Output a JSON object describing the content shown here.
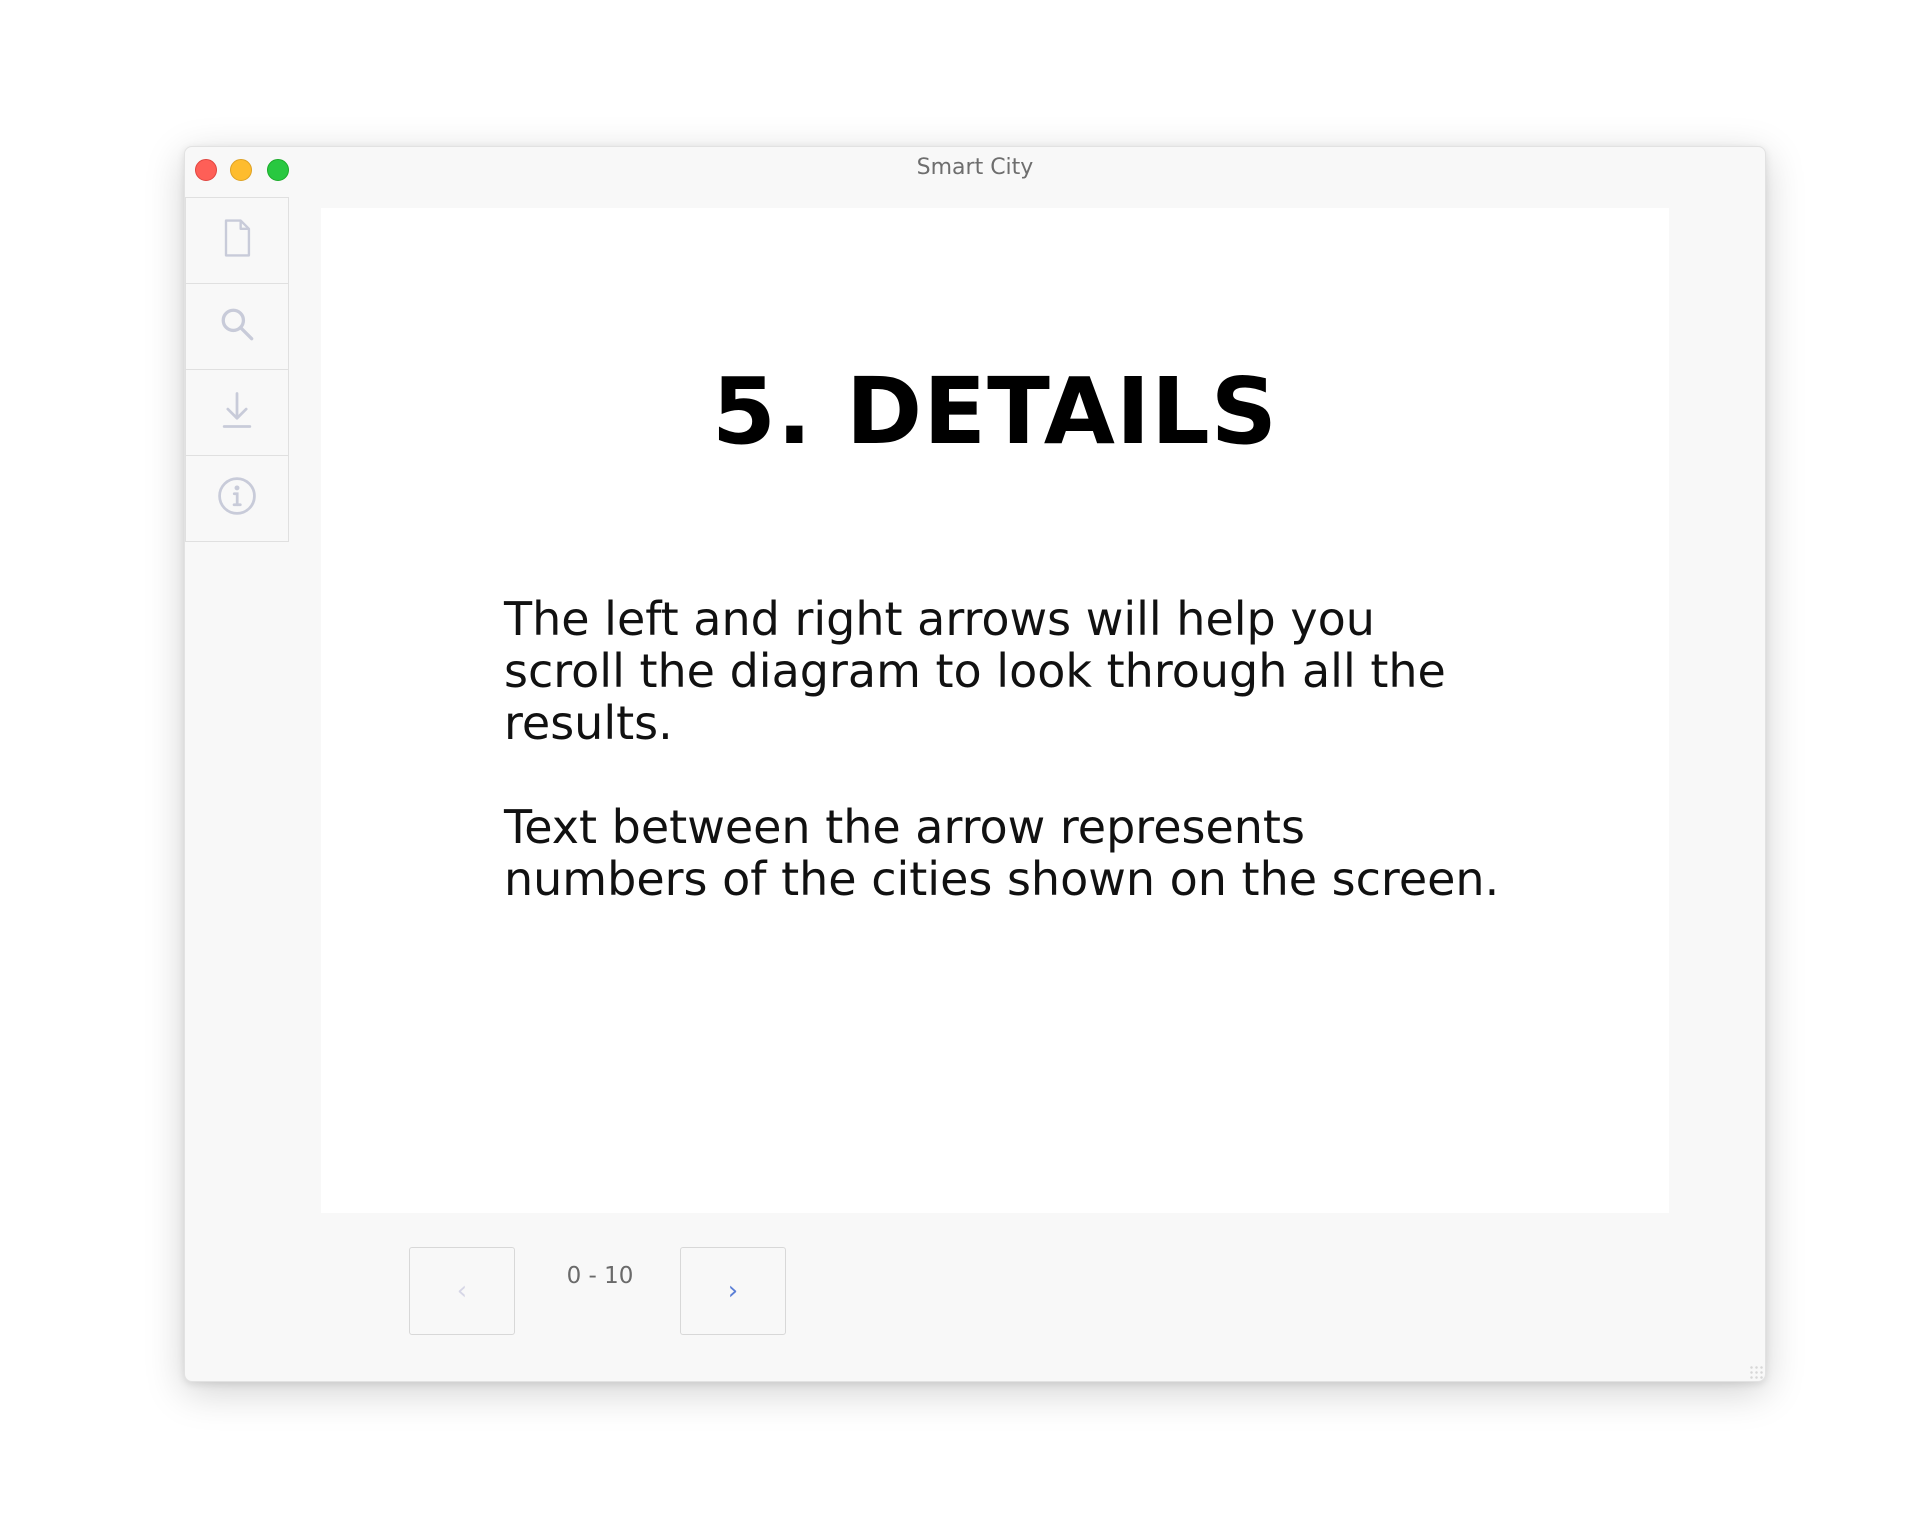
{
  "window": {
    "title": "Smart City"
  },
  "sidebar": {
    "items": [
      {
        "icon": "document-icon"
      },
      {
        "icon": "search-icon"
      },
      {
        "icon": "download-icon"
      },
      {
        "icon": "info-icon"
      }
    ]
  },
  "slide": {
    "title": "5. DETAILS",
    "paragraphs": [
      "The left and right arrows will help you scroll the diagram to look through all the results.",
      "Text between the arrow represents numbers of the cities shown on the screen."
    ]
  },
  "pager": {
    "prev_label": "‹",
    "range": "0 - 10",
    "next_label": "›"
  },
  "colors": {
    "icon": "#c8cbd9",
    "next_arrow": "#5b7fd6",
    "prev_arrow_disabled": "#d6d6e6"
  }
}
